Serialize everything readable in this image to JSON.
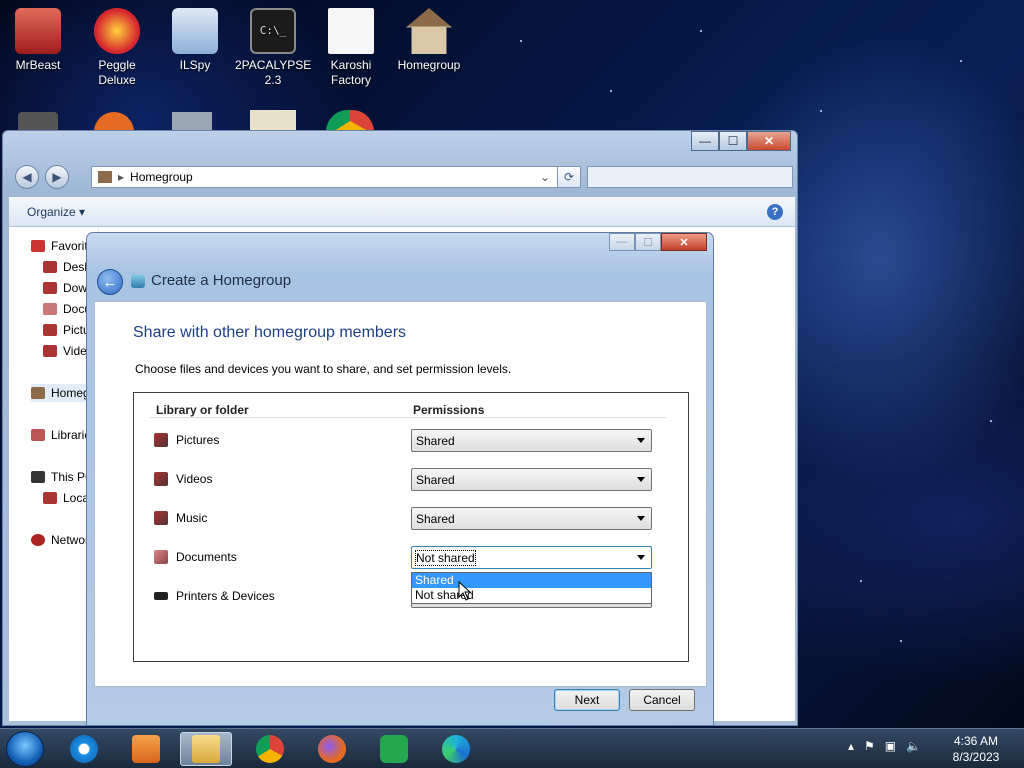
{
  "desktop": {
    "icons": [
      {
        "label": "MrBeast",
        "color": "#d0443a"
      },
      {
        "label": "Peggle Deluxe",
        "color": "#d6262f"
      },
      {
        "label": "ILSpy",
        "color": "#8fb0d8"
      },
      {
        "label": "2PACALYPSE 2.3",
        "color": "#2a2a2a"
      },
      {
        "label": "Karoshi Factory",
        "color": "#f2f2f2"
      },
      {
        "label": "Homegroup",
        "color": "#b07c4a"
      }
    ]
  },
  "explorer": {
    "address": "Homegroup",
    "organize_label": "Organize",
    "help_label": "?",
    "nav_items": [
      "Favorites",
      "Desktop",
      "Downloads",
      "Documents",
      "Pictures",
      "Videos",
      "Homegroup",
      "Libraries",
      "This PC",
      "Local Disk",
      "Network"
    ]
  },
  "dialog": {
    "title": "Create a Homegroup",
    "heading": "Share with other homegroup members",
    "instructions": "Choose files and devices you want to share, and set permission levels.",
    "col_library": "Library or folder",
    "col_permissions": "Permissions",
    "rows": [
      {
        "name": "Pictures",
        "permission": "Shared"
      },
      {
        "name": "Videos",
        "permission": "Shared"
      },
      {
        "name": "Music",
        "permission": "Shared"
      },
      {
        "name": "Documents",
        "permission": "Not shared"
      },
      {
        "name": "Printers & Devices",
        "permission": ""
      }
    ],
    "dropdown_options": [
      "Shared",
      "Not shared"
    ],
    "next_label": "Next",
    "cancel_label": "Cancel"
  },
  "taskbar": {
    "time": "4:36 AM",
    "date": "8/3/2023"
  }
}
